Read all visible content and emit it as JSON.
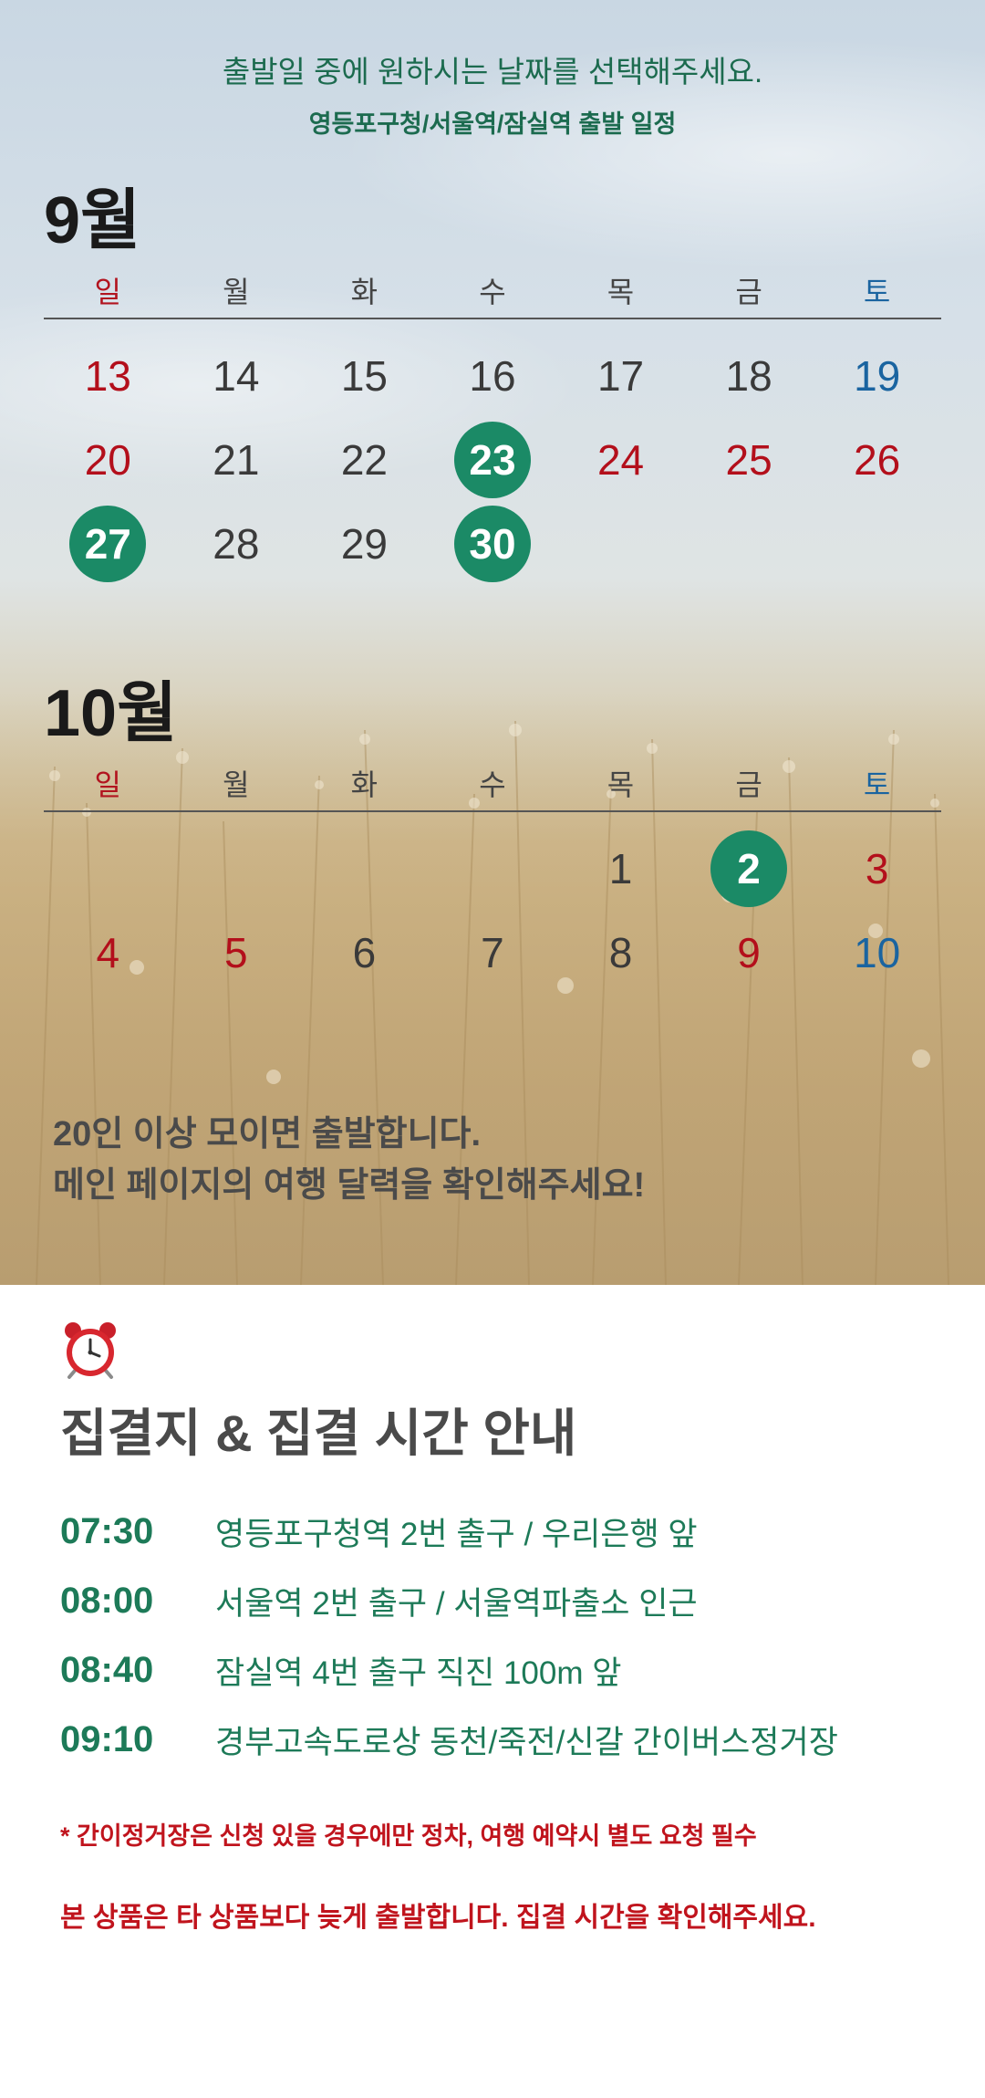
{
  "intro": {
    "main": "출발일 중에 원하시는 날짜를 선택해주세요.",
    "sub": "영등포구청/서울역/잠실역 출발 일정"
  },
  "weekdays": [
    "일",
    "월",
    "화",
    "수",
    "목",
    "금",
    "토"
  ],
  "september": {
    "title": "9월",
    "rows": [
      [
        {
          "d": "13",
          "t": "red"
        },
        {
          "d": "14",
          "t": ""
        },
        {
          "d": "15",
          "t": ""
        },
        {
          "d": "16",
          "t": ""
        },
        {
          "d": "17",
          "t": ""
        },
        {
          "d": "18",
          "t": ""
        },
        {
          "d": "19",
          "t": "blue"
        }
      ],
      [
        {
          "d": "20",
          "t": "red"
        },
        {
          "d": "21",
          "t": ""
        },
        {
          "d": "22",
          "t": ""
        },
        {
          "d": "23",
          "t": "sel"
        },
        {
          "d": "24",
          "t": "red"
        },
        {
          "d": "25",
          "t": "red"
        },
        {
          "d": "26",
          "t": "red"
        }
      ],
      [
        {
          "d": "27",
          "t": "sel"
        },
        {
          "d": "28",
          "t": ""
        },
        {
          "d": "29",
          "t": ""
        },
        {
          "d": "30",
          "t": "sel"
        },
        {
          "d": "",
          "t": ""
        },
        {
          "d": "",
          "t": ""
        },
        {
          "d": "",
          "t": ""
        }
      ]
    ]
  },
  "october": {
    "title": "10월",
    "rows": [
      [
        {
          "d": "",
          "t": ""
        },
        {
          "d": "",
          "t": ""
        },
        {
          "d": "",
          "t": ""
        },
        {
          "d": "",
          "t": ""
        },
        {
          "d": "1",
          "t": ""
        },
        {
          "d": "2",
          "t": "sel"
        },
        {
          "d": "3",
          "t": "red"
        }
      ],
      [
        {
          "d": "4",
          "t": "red"
        },
        {
          "d": "5",
          "t": "red"
        },
        {
          "d": "6",
          "t": ""
        },
        {
          "d": "7",
          "t": ""
        },
        {
          "d": "8",
          "t": ""
        },
        {
          "d": "9",
          "t": "red"
        },
        {
          "d": "10",
          "t": "blue"
        }
      ]
    ]
  },
  "notice": {
    "line1": "20인 이상 모이면 출발합니다.",
    "line2": "메인 페이지의 여행 달력을 확인해주세요!"
  },
  "meeting": {
    "title": "집결지 & 집결 시간 안내",
    "items": [
      {
        "time": "07:30",
        "place": "영등포구청역 2번 출구 / 우리은행 앞"
      },
      {
        "time": "08:00",
        "place": "서울역 2번 출구 / 서울역파출소 인근"
      },
      {
        "time": "08:40",
        "place": "잠실역 4번 출구 직진 100m 앞"
      },
      {
        "time": "09:10",
        "place": "경부고속도로상 동천/죽전/신갈 간이버스정거장"
      }
    ],
    "note1": "* 간이정거장은 신청 있을 경우에만 정차, 여행 예약시 별도 요청 필수",
    "note2": "본 상품은 타 상품보다 늦게 출발합니다. 집결 시간을 확인해주세요."
  },
  "colors": {
    "accent_green": "#1b8a66",
    "text_green": "#1d7a58",
    "holiday_red": "#b30f1b",
    "saturday_blue": "#1a64a0",
    "warning_red": "#c0141d"
  }
}
